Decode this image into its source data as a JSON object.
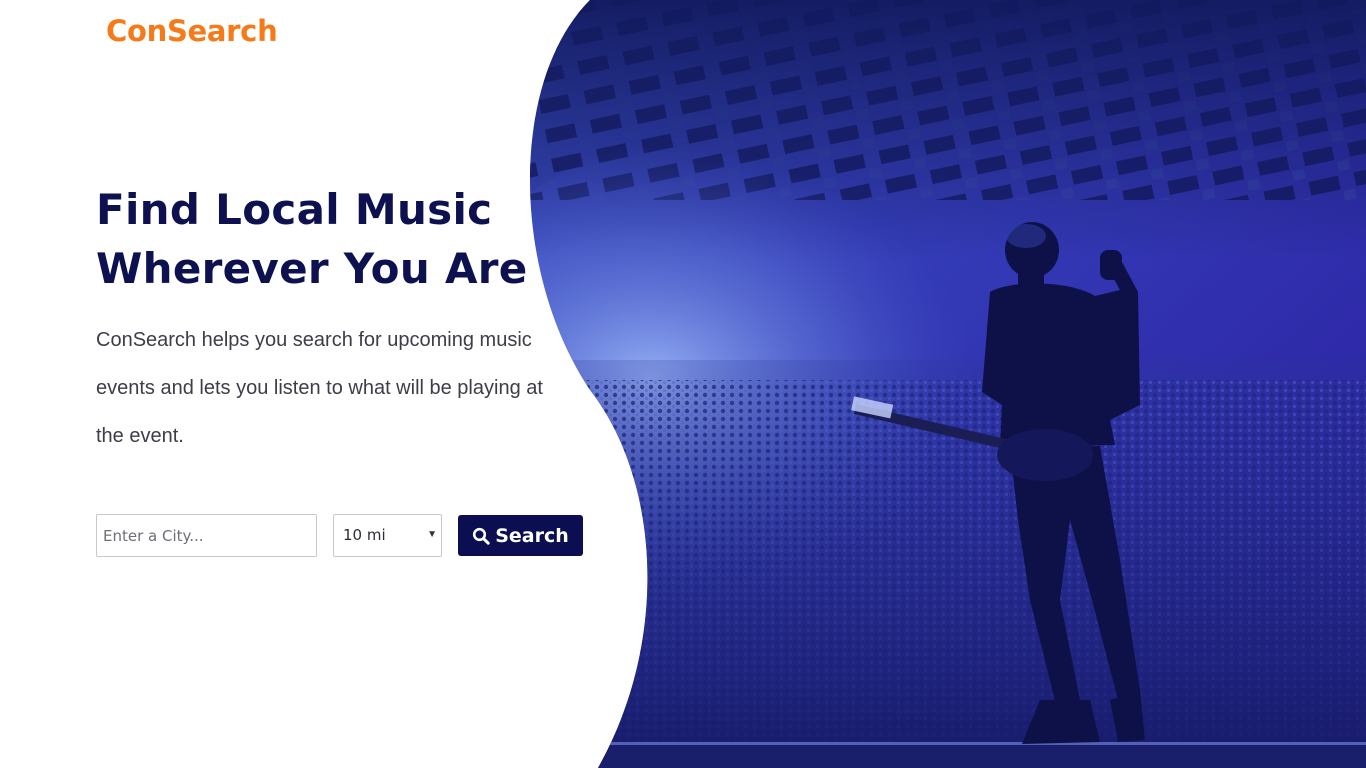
{
  "brand": {
    "logo_text": "ConSearch",
    "accent_color": "#f47a1a",
    "primary_color": "#0b0f52"
  },
  "hero": {
    "title_line1": "Find Local Music",
    "title_line2": "Wherever You Are",
    "description": "ConSearch helps you search for upcoming music events and lets you listen to what will be playing at the event.",
    "image_subject": "concert-performer-photo"
  },
  "search": {
    "city_placeholder": "Enter a City...",
    "city_value": "",
    "radius_selected": "10 mi",
    "button_label": "Search",
    "button_icon": "search-icon"
  }
}
